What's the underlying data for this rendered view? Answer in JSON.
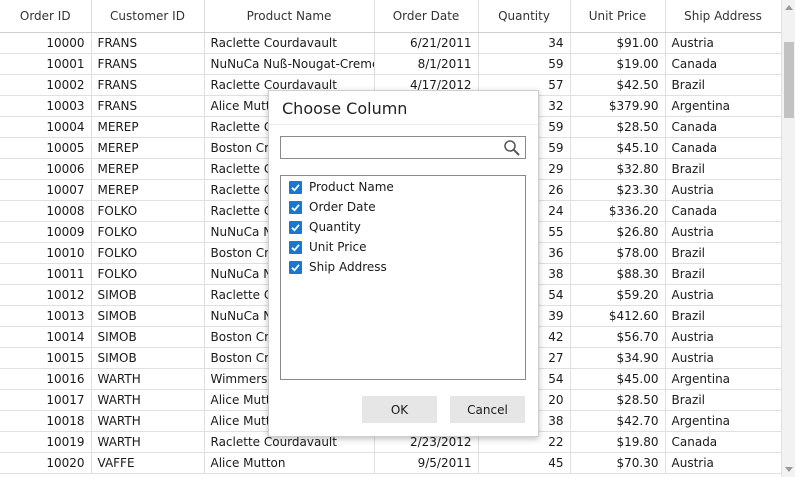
{
  "grid": {
    "columns": [
      "Order ID",
      "Customer ID",
      "Product Name",
      "Order Date",
      "Quantity",
      "Unit Price",
      "Ship Address"
    ],
    "rows": [
      [
        "10000",
        "FRANS",
        "Raclette Courdavault",
        "6/21/2011",
        "34",
        "$91.00",
        "Austria"
      ],
      [
        "10001",
        "FRANS",
        "NuNuCa Nuß-Nougat-Creme",
        "8/1/2011",
        "59",
        "$19.00",
        "Canada"
      ],
      [
        "10002",
        "FRANS",
        "Raclette Courdavault",
        "4/17/2012",
        "57",
        "$42.50",
        "Brazil"
      ],
      [
        "10003",
        "FRANS",
        "Alice Mutton",
        "",
        "32",
        "$379.90",
        "Argentina"
      ],
      [
        "10004",
        "MEREP",
        "Raclette Courdavault",
        "",
        "59",
        "$28.50",
        "Canada"
      ],
      [
        "10005",
        "MEREP",
        "Boston Crab Meat",
        "",
        "59",
        "$45.10",
        "Canada"
      ],
      [
        "10006",
        "MEREP",
        "Raclette Courdavault",
        "",
        "29",
        "$32.80",
        "Brazil"
      ],
      [
        "10007",
        "MEREP",
        "Raclette Courdavault",
        "",
        "26",
        "$23.30",
        "Austria"
      ],
      [
        "10008",
        "FOLKO",
        "Raclette Courdavault",
        "",
        "24",
        "$336.20",
        "Canada"
      ],
      [
        "10009",
        "FOLKO",
        "NuNuCa Nuß-Nougat-Creme",
        "",
        "55",
        "$26.80",
        "Austria"
      ],
      [
        "10010",
        "FOLKO",
        "Boston Crab Meat",
        "",
        "36",
        "$78.00",
        "Brazil"
      ],
      [
        "10011",
        "FOLKO",
        "NuNuCa Nuß-Nougat-Creme",
        "",
        "38",
        "$88.30",
        "Brazil"
      ],
      [
        "10012",
        "SIMOB",
        "Raclette Courdavault",
        "",
        "54",
        "$59.20",
        "Austria"
      ],
      [
        "10013",
        "SIMOB",
        "NuNuCa Nuß-Nougat-Creme",
        "",
        "39",
        "$412.60",
        "Brazil"
      ],
      [
        "10014",
        "SIMOB",
        "Boston Crab Meat",
        "",
        "42",
        "$56.70",
        "Austria"
      ],
      [
        "10015",
        "SIMOB",
        "Boston Crab Meat",
        "",
        "27",
        "$34.90",
        "Austria"
      ],
      [
        "10016",
        "WARTH",
        "Wimmers gute Semmelknödel",
        "",
        "54",
        "$45.00",
        "Argentina"
      ],
      [
        "10017",
        "WARTH",
        "Alice Mutton",
        "",
        "20",
        "$28.50",
        "Brazil"
      ],
      [
        "10018",
        "WARTH",
        "Alice Mutton",
        "",
        "38",
        "$42.70",
        "Argentina"
      ],
      [
        "10019",
        "WARTH",
        "Raclette Courdavault",
        "2/23/2012",
        "22",
        "$19.80",
        "Canada"
      ],
      [
        "10020",
        "VAFFE",
        "Alice Mutton",
        "9/5/2011",
        "45",
        "$70.30",
        "Austria"
      ]
    ]
  },
  "dialog": {
    "title": "Choose Column",
    "search_placeholder": "",
    "items": [
      "Product Name",
      "Order Date",
      "Quantity",
      "Unit Price",
      "Ship Address"
    ],
    "ok_label": "OK",
    "cancel_label": "Cancel",
    "check_color": "#1976d2"
  }
}
